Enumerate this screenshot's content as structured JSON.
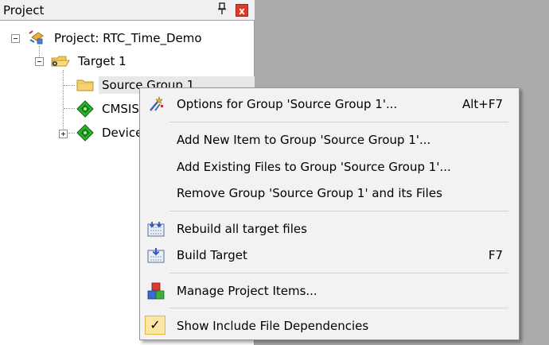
{
  "panel": {
    "title": "Project",
    "close_label": "x"
  },
  "tree": {
    "project": "Project: RTC_Time_Demo",
    "target": "Target 1",
    "source_group": "Source Group 1",
    "cmsis": "CMSIS",
    "device": "Device"
  },
  "menu": {
    "items": [
      {
        "label": "Options for Group 'Source Group 1'...",
        "shortcut": "Alt+F7"
      },
      {
        "label": "Add New  Item to Group 'Source Group 1'...",
        "shortcut": ""
      },
      {
        "label": "Add Existing Files to Group 'Source Group 1'...",
        "shortcut": ""
      },
      {
        "label": "Remove Group 'Source Group 1' and its Files",
        "shortcut": ""
      },
      {
        "label": "Rebuild all target files",
        "shortcut": ""
      },
      {
        "label": "Build Target",
        "shortcut": "F7"
      },
      {
        "label": "Manage Project Items...",
        "shortcut": ""
      },
      {
        "label": "Show Include File Dependencies",
        "shortcut": "",
        "checked": true
      }
    ]
  }
}
